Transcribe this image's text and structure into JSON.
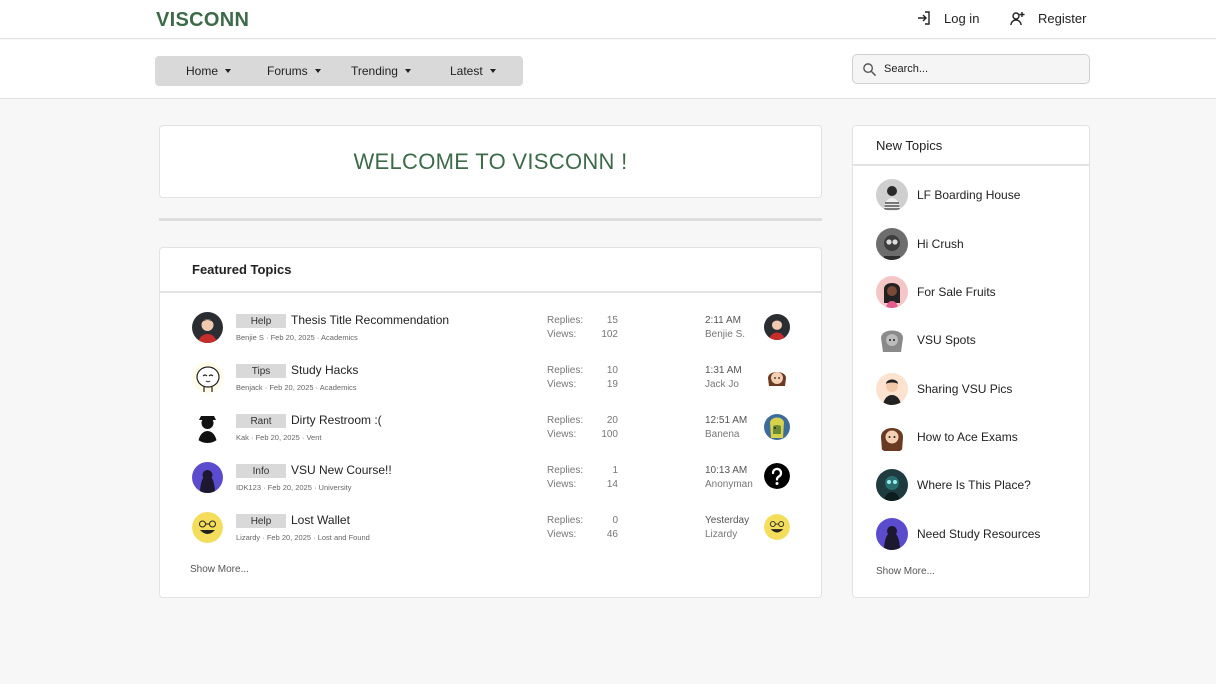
{
  "brand": "VISCONN",
  "auth": {
    "login": "Log in",
    "register": "Register"
  },
  "nav": {
    "items": [
      {
        "label": "Home"
      },
      {
        "label": "Forums"
      },
      {
        "label": "Trending"
      },
      {
        "label": "Latest"
      }
    ],
    "search_placeholder": "Search..."
  },
  "welcome": {
    "title": "WELCOME TO VISCONN !"
  },
  "featured": {
    "title": "Featured Topics",
    "replies_label": "Replies:",
    "views_label": "Views:",
    "show_more": "Show More...",
    "topics": [
      {
        "tag": "Help",
        "title": "Thesis Title Recommendation",
        "meta": "Benjie S · Feb 20, 2025 · Academics",
        "replies": "15",
        "views": "102",
        "last_time": "2:11 AM",
        "last_user": "Benjie S."
      },
      {
        "tag": "Tips",
        "title": "Study Hacks",
        "meta": "Benjack · Feb 20, 2025 · Academics",
        "replies": "10",
        "views": "19",
        "last_time": "1:31 AM",
        "last_user": "Jack Jo"
      },
      {
        "tag": "Rant",
        "title": "Dirty Restroom :(",
        "meta": "Kak · Feb 20, 2025 · Vent",
        "replies": "20",
        "views": "100",
        "last_time": "12:51 AM",
        "last_user": "Banena"
      },
      {
        "tag": "Info",
        "title": "VSU New Course!!",
        "meta": "IDK123 · Feb 20, 2025 · University",
        "replies": "1",
        "views": "14",
        "last_time": "10:13 AM",
        "last_user": "Anonyman"
      },
      {
        "tag": "Help",
        "title": "Lost Wallet",
        "meta": "Lizardy · Feb 20, 2025 · Lost and Found",
        "replies": "0",
        "views": "46",
        "last_time": "Yesterday",
        "last_user": "Lizardy"
      }
    ]
  },
  "new_topics": {
    "title": "New Topics",
    "show_more": "Show More...",
    "items": [
      {
        "title": "LF Boarding House"
      },
      {
        "title": "Hi Crush"
      },
      {
        "title": "For Sale Fruits"
      },
      {
        "title": "VSU Spots"
      },
      {
        "title": "Sharing VSU Pics"
      },
      {
        "title": "How to Ace Exams"
      },
      {
        "title": "Where Is This Place?"
      },
      {
        "title": "Need Study Resources"
      }
    ]
  },
  "colors": {
    "brand": "#3d6b4a",
    "menu_bg": "#d9d9d9",
    "tag_bg": "#d9d9d9",
    "page_bg": "#f7f7f7"
  }
}
